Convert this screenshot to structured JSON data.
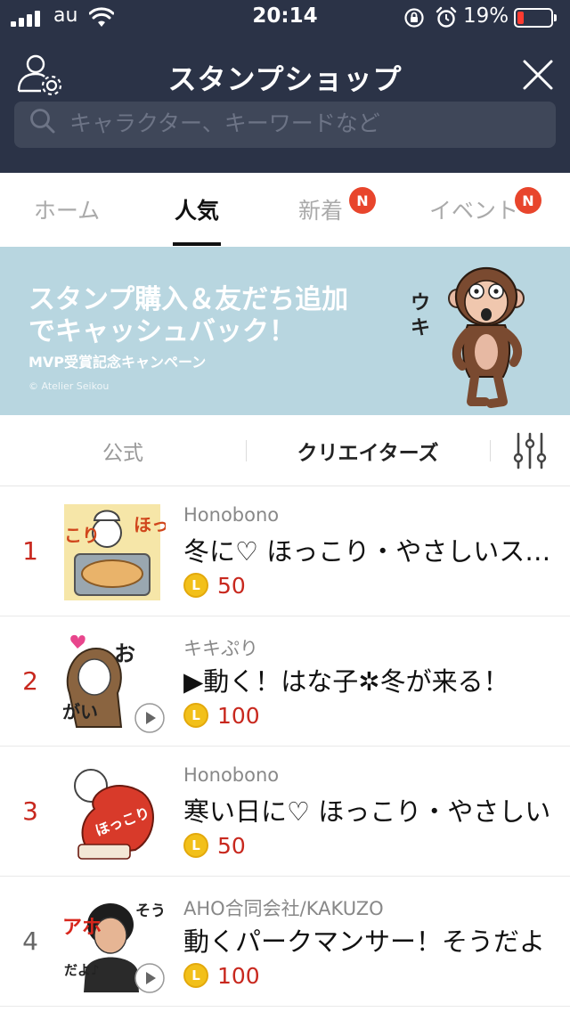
{
  "status_bar": {
    "carrier": "au",
    "time": "20:14",
    "battery_percent": "19%",
    "battery_level": 0.19,
    "battery_color": "#ff3b30"
  },
  "header": {
    "title": "スタンプショップ",
    "left_icon": "user-settings-icon",
    "right_icon": "close-icon",
    "background": "#2b3347"
  },
  "search": {
    "placeholder": "キャラクター、キーワードなど"
  },
  "tabs": [
    {
      "label": "ホーム",
      "active": false,
      "badge": ""
    },
    {
      "label": "人気",
      "active": true,
      "badge": ""
    },
    {
      "label": "新着",
      "active": false,
      "badge": "N"
    },
    {
      "label": "イベント",
      "active": false,
      "badge": "N"
    }
  ],
  "banner": {
    "line1": "スタンプ購入＆友だち追加",
    "line2": "でキャッシュバック！",
    "subtitle": "MVP受賞記念キャンペーン",
    "copyright": "© Atelier Seikou",
    "character_text": "ウキ",
    "background": "#b8d6e0"
  },
  "segment": {
    "official": "公式",
    "creators": "クリエイターズ",
    "active": "creators",
    "filter_icon": "filter-sliders-icon"
  },
  "stickers": [
    {
      "rank": "1",
      "rank_color": "#c8281e",
      "author": "Honobono",
      "title": "冬に♡ ほっこり・やさしいスタンプ",
      "price": "50",
      "animated": false,
      "thumb_text": [
        "ほっ",
        "こり"
      ]
    },
    {
      "rank": "2",
      "rank_color": "#c8281e",
      "author": "キキぷり",
      "title": "▶動く！はな子✲冬が来る！",
      "price": "100",
      "animated": true,
      "thumb_text": [
        "お",
        "がい"
      ]
    },
    {
      "rank": "3",
      "rank_color": "#c8281e",
      "author": "Honobono",
      "title": "寒い日に♡ ほっこり・やさしい",
      "price": "50",
      "animated": false,
      "thumb_text": [
        "ほっこり"
      ]
    },
    {
      "rank": "4",
      "rank_color": "#666666",
      "author": "AHO合同会社/KAKUZO",
      "title": "動くパークマンサー！そうだよ",
      "price": "100",
      "animated": true,
      "thumb_text": [
        "アホ",
        "だよ♪",
        "そうだ"
      ]
    }
  ],
  "coin_label": "L",
  "accent_price_color": "#c8281e",
  "badge_color": "#e8452c"
}
